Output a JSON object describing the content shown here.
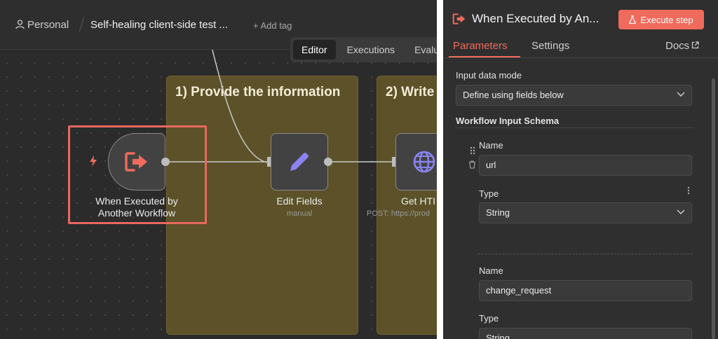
{
  "canvas": {
    "breadcrumb": {
      "project": "Personal",
      "workflow_name": "Self-healing client-side test ...",
      "add_tag": "+ Add tag"
    },
    "view_tabs": [
      {
        "label": "Editor",
        "active": true
      },
      {
        "label": "Executions",
        "active": false
      },
      {
        "label": "Evalu",
        "active": false
      }
    ],
    "sticky_notes": [
      {
        "title": "1) Provide the information"
      },
      {
        "title": "2) Write"
      }
    ],
    "nodes": {
      "trigger": {
        "label": "When Executed by\nAnother Workflow",
        "icon": "sign-out-icon",
        "color": "#ef6b5c"
      },
      "edit_fields": {
        "label": "Edit Fields",
        "subtitle": "manual",
        "icon": "pencil-icon",
        "color": "#8b83f0"
      },
      "http": {
        "label": "Get HTI",
        "subtitle": "POST: https://prod",
        "icon": "globe-icon",
        "color": "#8b83f0"
      }
    },
    "colors": {
      "highlight": "#e8685f",
      "sticky": "#5c5128"
    }
  },
  "ndv": {
    "title": "When Executed by An...",
    "execute_button": "Execute step",
    "tabs": [
      {
        "label": "Parameters",
        "active": true
      },
      {
        "label": "Settings",
        "active": false
      }
    ],
    "docs_link": "Docs",
    "input_data_mode": {
      "label": "Input data mode",
      "value": "Define using fields below"
    },
    "schema_label": "Workflow Input Schema",
    "fields": [
      {
        "name_label": "Name",
        "name_value": "url",
        "type_label": "Type",
        "type_value": "String"
      },
      {
        "name_label": "Name",
        "name_value": "change_request",
        "type_label": "Type",
        "type_value": "String"
      }
    ],
    "colors": {
      "accent": "#ef6b5c"
    }
  }
}
